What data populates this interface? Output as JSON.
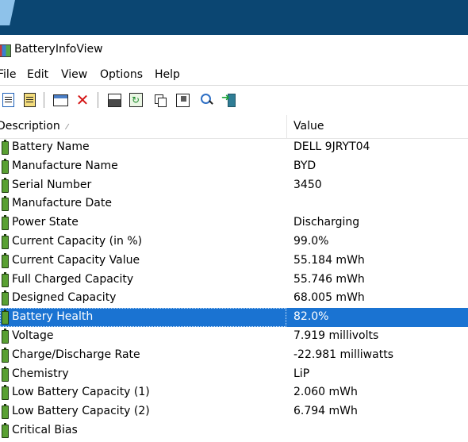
{
  "window": {
    "title": "BatteryInfoView"
  },
  "menu": [
    "File",
    "Edit",
    "View",
    "Options",
    "Help"
  ],
  "toolbar": {
    "buttons": [
      {
        "icon": "html-report-icon"
      },
      {
        "icon": "text-report-icon"
      },
      {
        "icon": "window-icon"
      },
      {
        "icon": "delete-icon"
      },
      {
        "icon": "save-icon"
      },
      {
        "icon": "refresh-icon"
      },
      {
        "icon": "copy-icon"
      },
      {
        "icon": "properties-icon"
      },
      {
        "icon": "find-icon"
      },
      {
        "icon": "exit-icon"
      }
    ]
  },
  "columns": {
    "description": "Description",
    "value": "Value"
  },
  "rows": [
    {
      "name": "Battery Name",
      "value": "DELL 9JRYT04"
    },
    {
      "name": "Manufacture Name",
      "value": "BYD"
    },
    {
      "name": "Serial Number",
      "value": "3450"
    },
    {
      "name": "Manufacture Date",
      "value": ""
    },
    {
      "name": "Power State",
      "value": "Discharging"
    },
    {
      "name": "Current Capacity (in %)",
      "value": "99.0%"
    },
    {
      "name": "Current Capacity Value",
      "value": "55.184 mWh"
    },
    {
      "name": "Full Charged Capacity",
      "value": "55.746 mWh"
    },
    {
      "name": "Designed Capacity",
      "value": "68.005 mWh"
    },
    {
      "name": "Battery Health",
      "value": "82.0%",
      "selected": true
    },
    {
      "name": "Voltage",
      "value": "7.919 millivolts"
    },
    {
      "name": "Charge/Discharge Rate",
      "value": "-22.981 milliwatts"
    },
    {
      "name": "Chemistry",
      "value": "LiP"
    },
    {
      "name": "Low Battery Capacity (1)",
      "value": "2.060 mWh"
    },
    {
      "name": "Low Battery Capacity (2)",
      "value": "6.794 mWh"
    },
    {
      "name": "Critical Bias",
      "value": ""
    }
  ],
  "colors": {
    "selection": "#1a73d2",
    "desktop": "#0b4672"
  }
}
